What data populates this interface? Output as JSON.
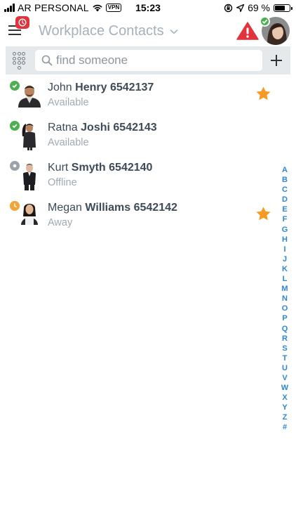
{
  "status_bar": {
    "carrier": "AR PERSONAL",
    "vpn": "VPN",
    "time": "15:23",
    "battery": "69 %",
    "battery_level": 0.69
  },
  "header": {
    "title": "Workplace Contacts",
    "notification_icon": "clock-icon",
    "alert_icon": "warning-icon",
    "my_status_color": "#4caf50"
  },
  "search": {
    "placeholder": "find someone",
    "value": ""
  },
  "contacts": [
    {
      "first": "John",
      "last": "Henry",
      "ext": "6542137",
      "status": "Available",
      "presence": "available",
      "favorite": true
    },
    {
      "first": "Ratna",
      "last": "Joshi",
      "ext": "6542143",
      "status": "Available",
      "presence": "available",
      "favorite": false
    },
    {
      "first": "Kurt",
      "last": "Smyth",
      "ext": "6542140",
      "status": "Offline",
      "presence": "offline",
      "favorite": false
    },
    {
      "first": "Megan",
      "last": "Williams",
      "ext": "6542142",
      "status": "Away",
      "presence": "away",
      "favorite": true
    }
  ],
  "alphabet": [
    "A",
    "B",
    "C",
    "D",
    "E",
    "F",
    "G",
    "H",
    "I",
    "J",
    "K",
    "L",
    "M",
    "N",
    "O",
    "P",
    "Q",
    "R",
    "S",
    "T",
    "U",
    "V",
    "W",
    "X",
    "Y",
    "Z",
    "#"
  ],
  "colors": {
    "available": "#4caf50",
    "offline": "#9aa3ab",
    "away": "#f0a43a",
    "favorite": "#f59a23",
    "alert": "#e2323c",
    "index": "#2e86d6"
  }
}
